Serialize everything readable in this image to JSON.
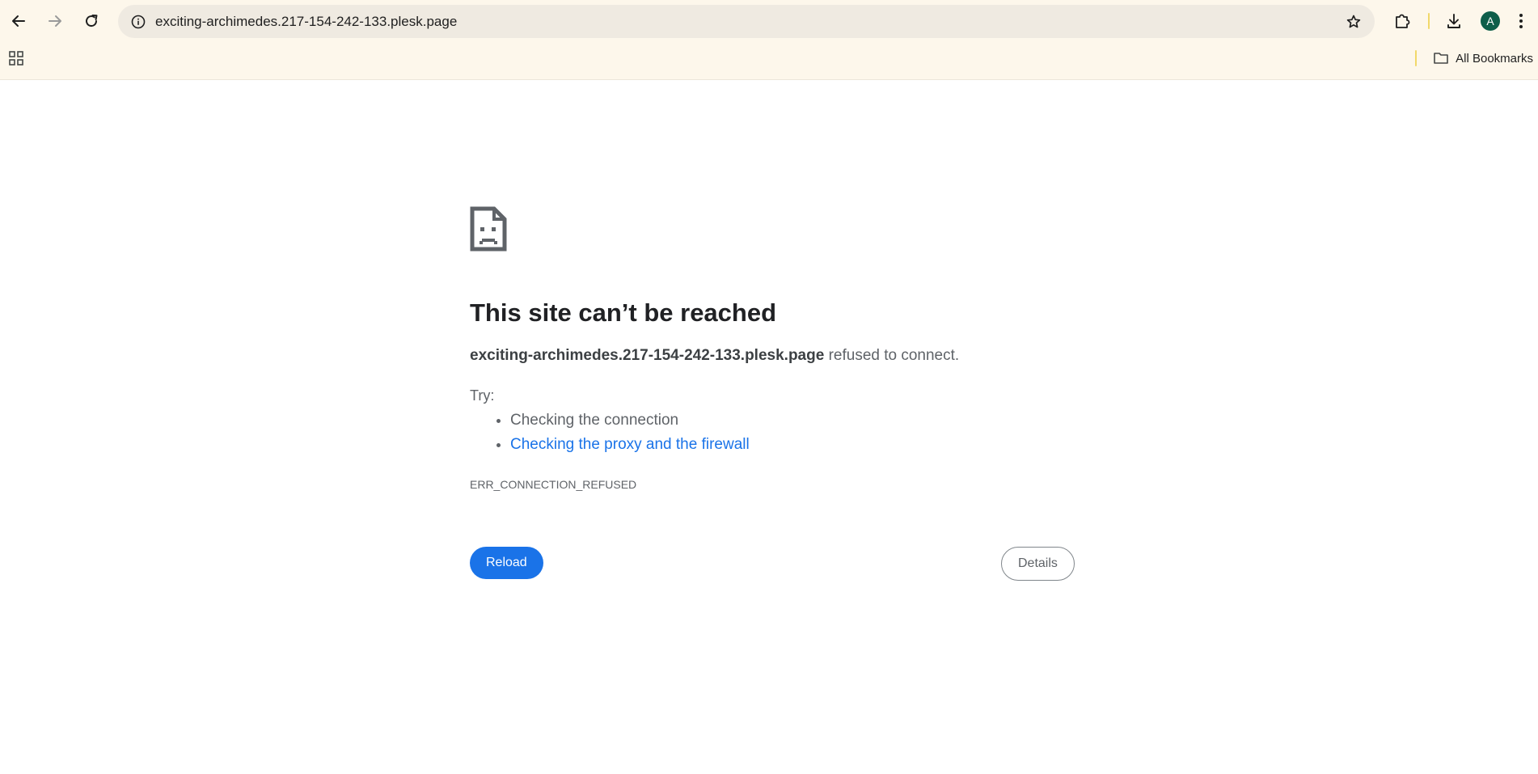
{
  "browser": {
    "address_bar": {
      "url": "exciting-archimedes.217-154-242-133.plesk.page"
    },
    "profile_initial": "A",
    "bookmarks": {
      "all_bookmarks_label": "All Bookmarks"
    },
    "icons": [
      "back-arrow-icon",
      "forward-arrow-icon",
      "reload-icon",
      "site-info-icon",
      "star-icon",
      "extensions-icon",
      "download-icon",
      "more-vert-icon",
      "apps-grid-icon",
      "folder-icon"
    ],
    "colors": {
      "toolbar_bg": "#fdf7eb",
      "omnibox_bg": "#efeae1",
      "avatar_bg": "#0e5e4a"
    }
  },
  "error_page": {
    "title": "This site can’t be reached",
    "host": "exciting-archimedes.217-154-242-133.plesk.page",
    "summary_suffix": " refused to connect.",
    "try_label": "Try:",
    "suggestions": {
      "check_connection": "Checking the connection",
      "check_proxy": "Checking the proxy and the firewall"
    },
    "error_code": "ERR_CONNECTION_REFUSED",
    "reload_label": "Reload",
    "details_label": "Details",
    "colors": {
      "primary": "#1a73e8",
      "text": "#202124",
      "secondary_text": "#5f6368"
    }
  }
}
